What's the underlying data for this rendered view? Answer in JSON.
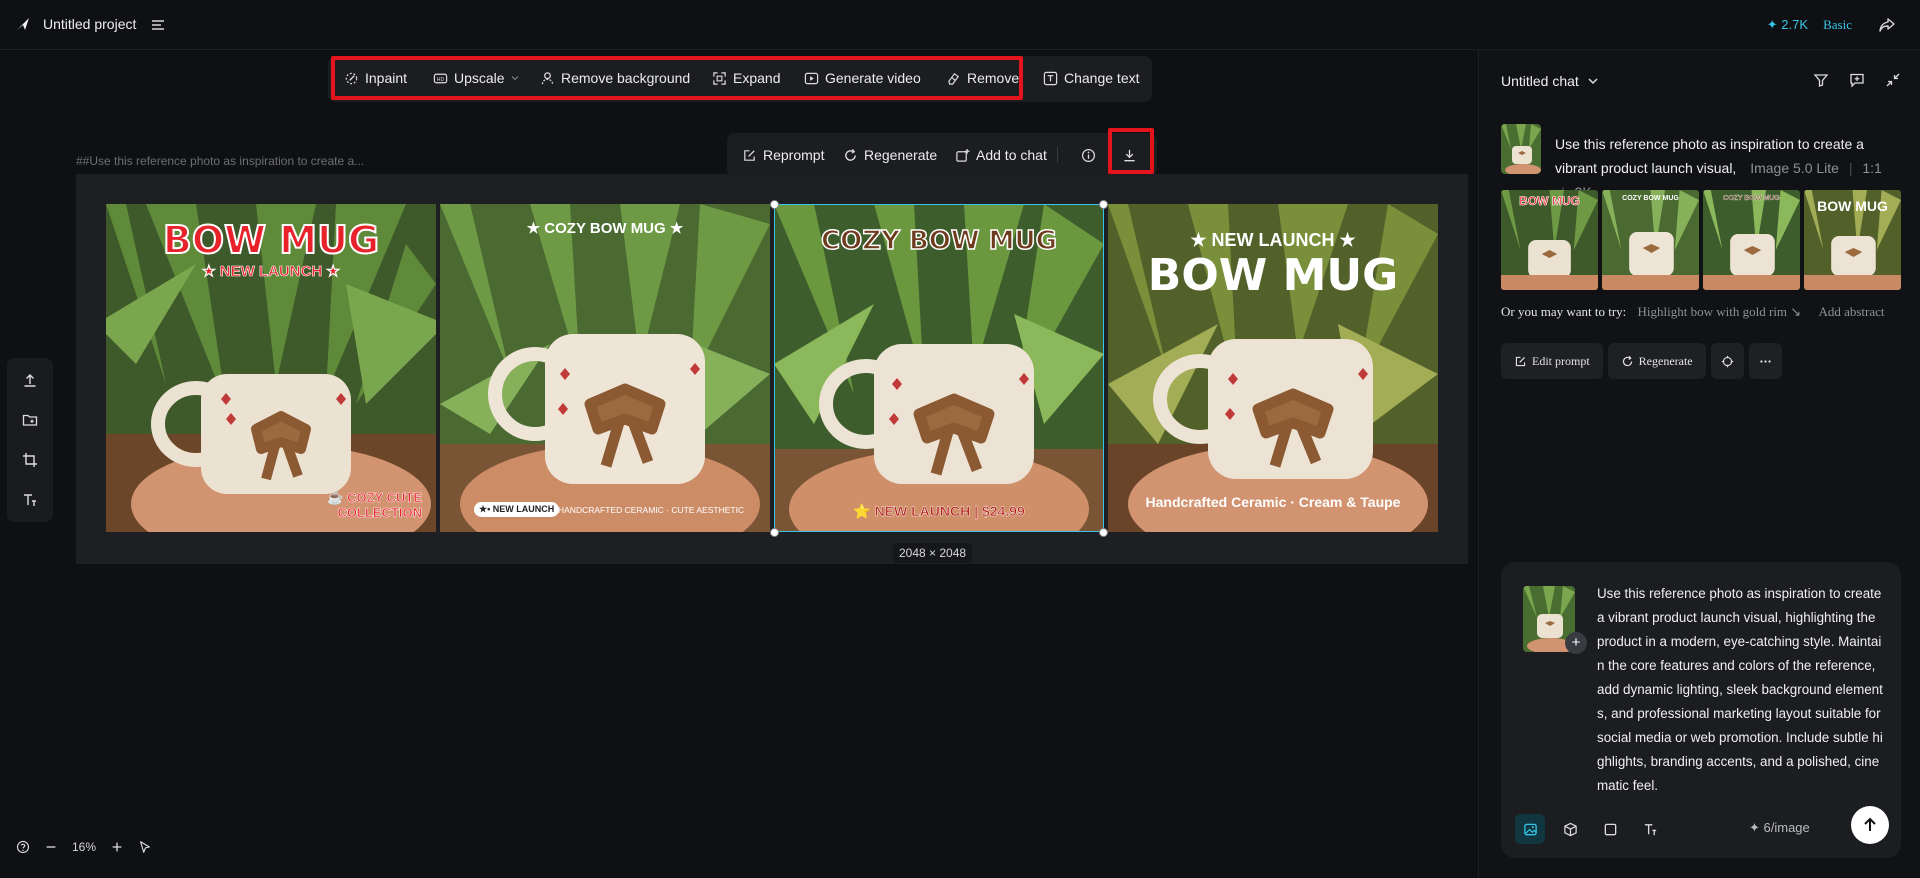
{
  "app": {
    "project_title": "Untitled project",
    "credits": "✦ 2.7K",
    "plan": "Basic",
    "accent": "#36c3e6",
    "highlight": "#e3141b"
  },
  "toolbar": {
    "inpaint": "Inpaint",
    "upscale": "Upscale",
    "remove_background": "Remove background",
    "expand": "Expand",
    "generate_video": "Generate video",
    "remove": "Remove",
    "change_text": "Change text"
  },
  "image_actions": {
    "reprompt": "Reprompt",
    "regenerate": "Regenerate",
    "add_to_chat": "Add to chat"
  },
  "canvas": {
    "prompt_caption": "##Use this reference photo as inspiration to create a...",
    "dimensions": "2048 × 2048",
    "images": [
      {
        "headline": "BOW MUG",
        "sub": "★ NEW LAUNCH ★",
        "badge": "☕ COZY CUTE",
        "badge2": "COLLECTION"
      },
      {
        "headline": "★ COZY BOW MUG ★",
        "badge": "★• NEW LAUNCH",
        "footer": "HANDCRAFTED CERAMIC · CUTE AESTHETIC"
      },
      {
        "headline": "COZY BOW MUG",
        "footer": "⭐ NEW LAUNCH | $24.99"
      },
      {
        "headline": "★ NEW LAUNCH ★",
        "sub": "BOW MUG",
        "footer": "Handcrafted Ceramic · Cream & Taupe"
      }
    ]
  },
  "zoom": {
    "level": "16%"
  },
  "chat": {
    "title": "Untitled chat",
    "message_text": "Use this reference photo as inspiration to create a vibrant product launch visual,",
    "meta_model": "Image 5.0 Lite",
    "meta_ratio": "1:1",
    "meta_res": "2K",
    "results": [
      {
        "headline": "BOW MUG"
      },
      {
        "headline": "COZY BOW MUG"
      },
      {
        "headline": "COZY BOW MUG"
      },
      {
        "headline": "BOW MUG"
      }
    ],
    "suggest_label": "Or you may want to try:",
    "suggest_1": "Highlight bow with gold rim ↘",
    "suggest_2": "Add abstract",
    "edit_prompt": "Edit prompt",
    "regenerate": "Regenerate"
  },
  "composer": {
    "text": "Use this reference photo as inspiration to create a vibrant product launch visual, highlighting the product in a modern, eye-catching style. Maintain the core features and colors of the reference, add dynamic lighting, sleek background elements, and professional marketing layout suitable for social media or web promotion. Include subtle highlights, branding accents, and a polished, cinematic feel.",
    "cost": "✦ 6/image"
  }
}
